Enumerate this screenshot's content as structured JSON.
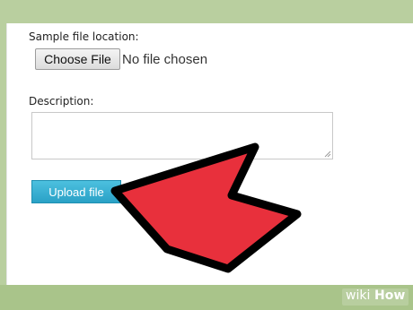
{
  "form": {
    "file_label": "Sample file location:",
    "choose_button": "Choose File",
    "no_file_text": "No file chosen",
    "description_label": "Description:",
    "description_value": "",
    "upload_button": "Upload file"
  },
  "annotation": {
    "icon": "arrow-pointer-icon",
    "fill_color": "#e8303c",
    "outline_color": "#000000"
  },
  "watermark": {
    "wiki": "wiki",
    "how": "How"
  },
  "colors": {
    "background": "#b9cf9f",
    "upload_button": "#2aa1c6"
  }
}
